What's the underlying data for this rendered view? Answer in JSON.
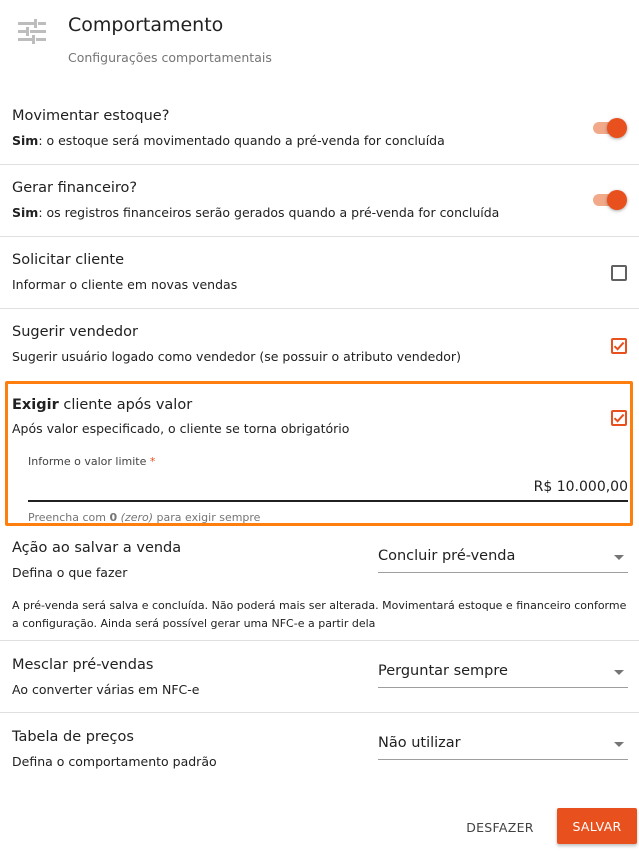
{
  "header": {
    "title": "Comportamento",
    "subtitle": "Configurações comportamentais",
    "icon": "sliders-icon"
  },
  "settings": {
    "stock": {
      "title": "Movimentar estoque?",
      "desc_bold": "Sim",
      "desc_rest": ": o estoque será movimentado quando a pré-venda for concluída",
      "control": "toggle",
      "on": true
    },
    "financial": {
      "title": "Gerar financeiro?",
      "desc_bold": "Sim",
      "desc_rest": ": os registros financeiros serão gerados quando a pré-venda for concluída",
      "control": "toggle",
      "on": true
    },
    "request_client": {
      "title": "Solicitar cliente",
      "desc": "Informar o cliente em novas vendas",
      "checked": false
    },
    "suggest_seller": {
      "title": "Sugerir vendedor",
      "desc": "Sugerir usuário logado como vendedor (se possuir o atributo vendedor)",
      "checked": true
    },
    "require_client": {
      "title_bold": "Exigir",
      "title_rest": " cliente após valor",
      "desc": "Após valor especificado, o cliente se torna obrigatório",
      "checked": true,
      "input_label": "Informe o valor limite",
      "required_mark": "*",
      "input_value": "R$ 10.000,00",
      "hint_prefix": "Preencha com ",
      "hint_bold": "0",
      "hint_italic": "(zero)",
      "hint_suffix": " para exigir sempre"
    },
    "save_action": {
      "title": "Ação ao salvar a venda",
      "desc": "Defina o que fazer",
      "selected": "Concluir pré-venda",
      "note": "A pré-venda será salva e concluída. Não poderá mais ser alterada. Movimentará estoque e financeiro conforme a configuração. Ainda será possível gerar uma NFC-e a partir dela"
    },
    "merge": {
      "title": "Mesclar pré-vendas",
      "desc": "Ao converter várias em NFC-e",
      "selected": "Perguntar sempre"
    },
    "price_table": {
      "title": "Tabela de preços",
      "desc": "Defina o comportamento padrão",
      "selected": "Não utilizar"
    }
  },
  "actions": {
    "undo_label": "DESFAZER",
    "save_label": "SALVAR"
  },
  "colors": {
    "accent": "#e8501e",
    "toggle_track": "#f2a98a",
    "highlight": "#ff7f0e",
    "divider": "#e0e0e0"
  }
}
